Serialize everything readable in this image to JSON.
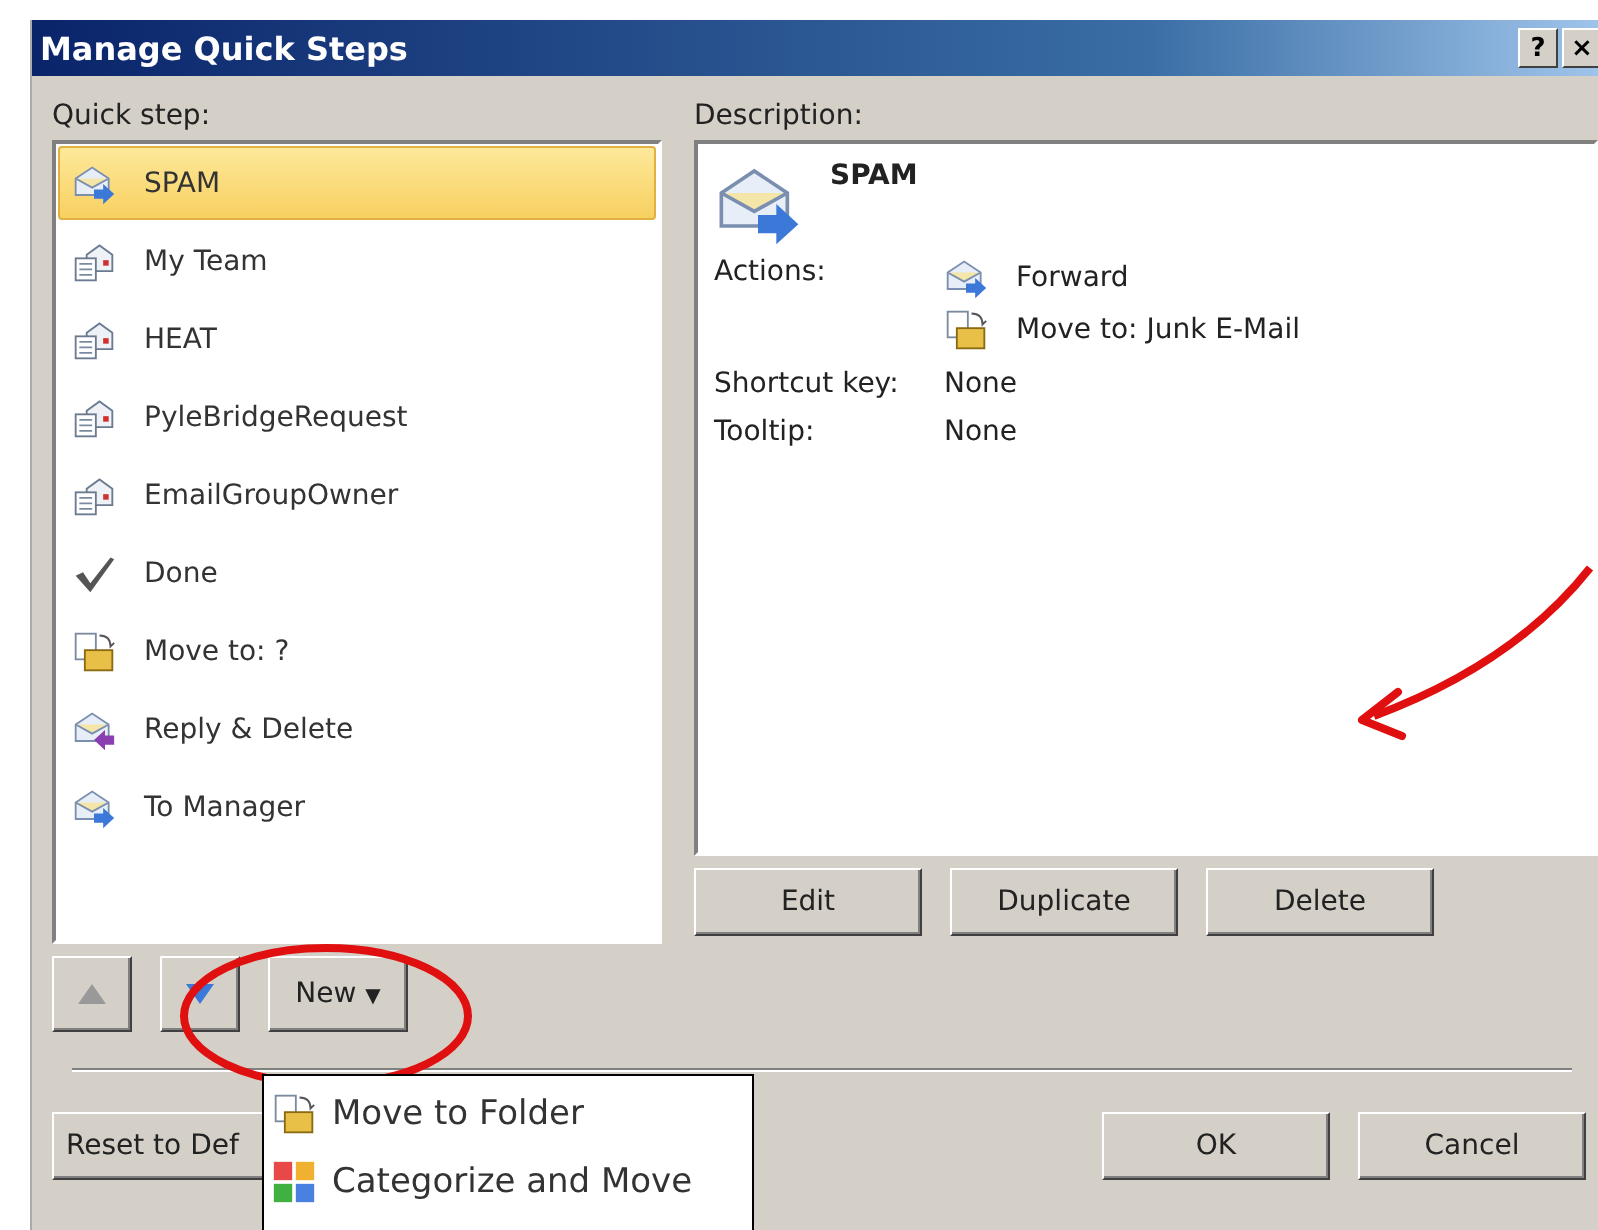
{
  "window": {
    "title": "Manage Quick Steps",
    "buttons": [
      "?",
      "×"
    ]
  },
  "quick_step": {
    "label": "Quick step:",
    "items": [
      {
        "label": "SPAM",
        "kind": "forward",
        "selected": true
      },
      {
        "label": "My Team",
        "kind": "team",
        "selected": false
      },
      {
        "label": "HEAT",
        "kind": "team",
        "selected": false
      },
      {
        "label": "PyleBridgeRequest",
        "kind": "team",
        "selected": false
      },
      {
        "label": "EmailGroupOwner",
        "kind": "team",
        "selected": false
      },
      {
        "label": "Done",
        "kind": "check",
        "selected": false
      },
      {
        "label": "Move to: ?",
        "kind": "move",
        "selected": false
      },
      {
        "label": "Reply & Delete",
        "kind": "reply",
        "selected": false
      },
      {
        "label": "To Manager",
        "kind": "forward",
        "selected": false
      }
    ]
  },
  "description": {
    "label": "Description:",
    "title": "SPAM",
    "actions_label": "Actions:",
    "actions": [
      {
        "label": "Forward",
        "kind": "forward"
      },
      {
        "label": "Move to: Junk E-Mail",
        "kind": "move"
      }
    ],
    "shortcut_label": "Shortcut key:",
    "shortcut": "None",
    "tooltip_label": "Tooltip:",
    "tooltip": "None"
  },
  "description_buttons": [
    "Edit",
    "Duplicate",
    "Delete"
  ],
  "new_button": {
    "label": "New",
    "caret": "▼"
  },
  "new_menu": [
    {
      "label": "Move to Folder",
      "kind": "move"
    },
    {
      "label": "Categorize and Move",
      "kind": "categorize"
    }
  ],
  "reset_button": "Reset to Def",
  "footer_buttons": [
    "OK",
    "Cancel"
  ]
}
